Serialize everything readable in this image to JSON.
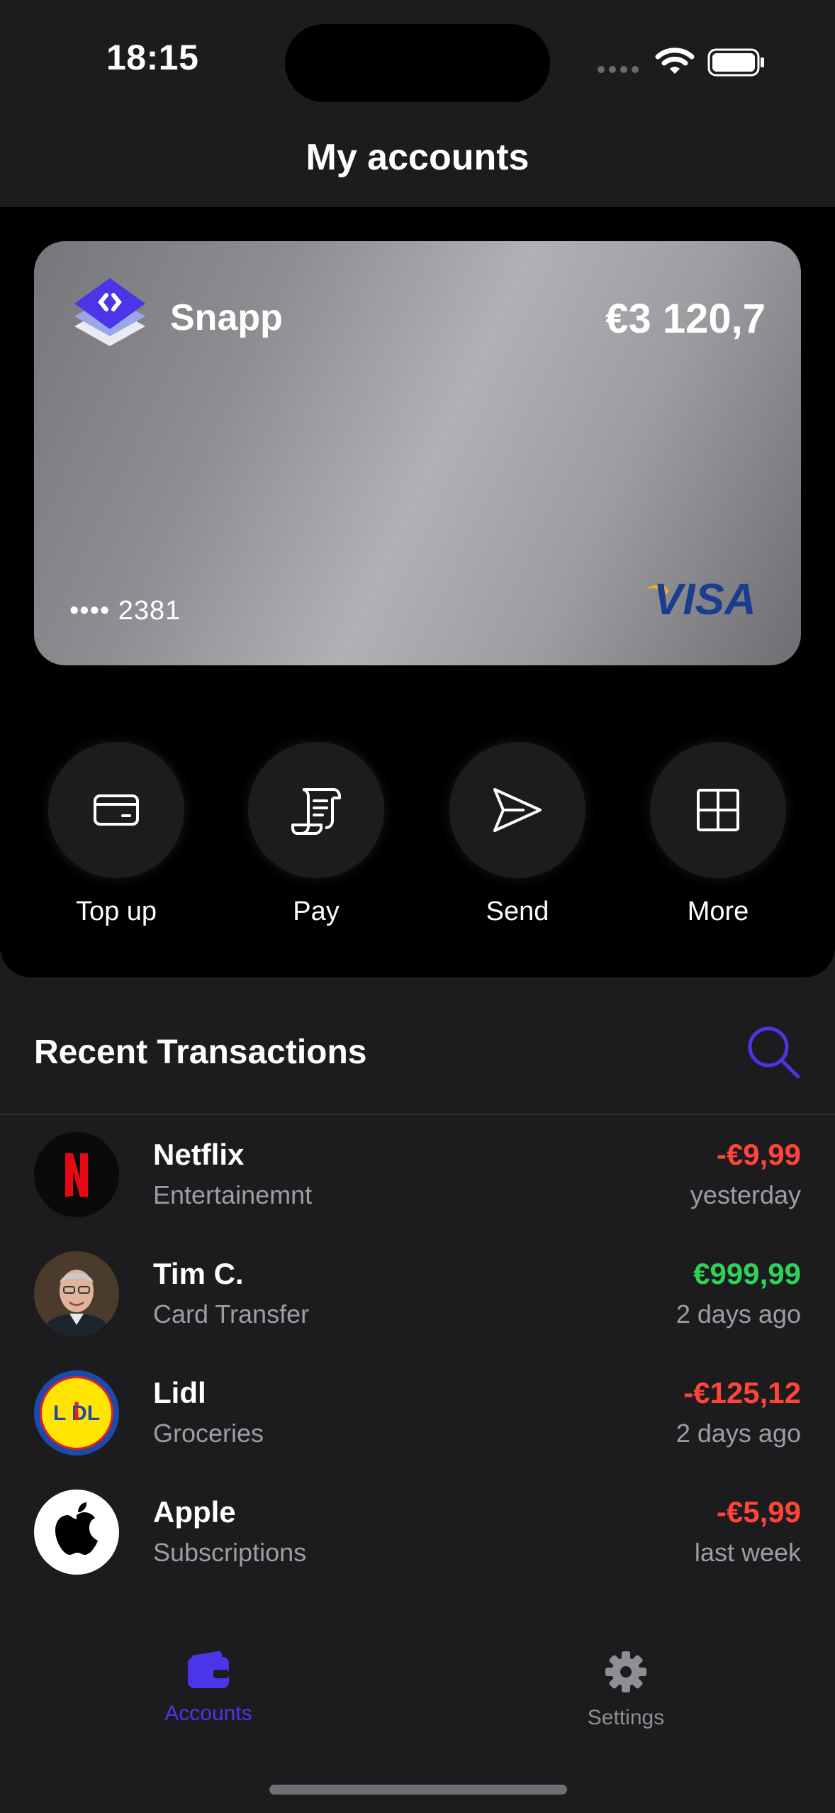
{
  "status_bar": {
    "time": "18:15"
  },
  "header": {
    "title": "My accounts"
  },
  "card": {
    "brand": "Snapp",
    "balance": "€3 120,7",
    "number": "•••• 2381",
    "network": "VISA"
  },
  "actions": [
    {
      "label": "Top up",
      "icon": "card-icon"
    },
    {
      "label": "Pay",
      "icon": "receipt-icon"
    },
    {
      "label": "Send",
      "icon": "send-icon"
    },
    {
      "label": "More",
      "icon": "grid-icon"
    }
  ],
  "transactions": {
    "title": "Recent Transactions",
    "items": [
      {
        "name": "Netflix",
        "category": "Entertainemnt",
        "amount": "-€9,99",
        "time": "yesterday",
        "amount_color": "#ff453a",
        "avatar": "netflix-logo"
      },
      {
        "name": "Tim C.",
        "category": "Card Transfer",
        "amount": "€999,99",
        "time": "2 days ago",
        "amount_color": "#30d158",
        "avatar": "person-photo"
      },
      {
        "name": "Lidl",
        "category": "Groceries",
        "amount": "-€125,12",
        "time": "2 days ago",
        "amount_color": "#ff453a",
        "avatar": "lidl-logo"
      },
      {
        "name": "Apple",
        "category": "Subscriptions",
        "amount": "-€5,99",
        "time": "last week",
        "amount_color": "#ff453a",
        "avatar": "apple-logo"
      }
    ]
  },
  "tab_bar": {
    "items": [
      {
        "label": "Accounts",
        "icon": "wallet-icon",
        "active": true
      },
      {
        "label": "Settings",
        "icon": "gear-icon",
        "active": false
      }
    ]
  },
  "colors": {
    "accent": "#4a35e8",
    "positive": "#30d158",
    "negative": "#ff453a",
    "background": "#1c1c1e"
  }
}
